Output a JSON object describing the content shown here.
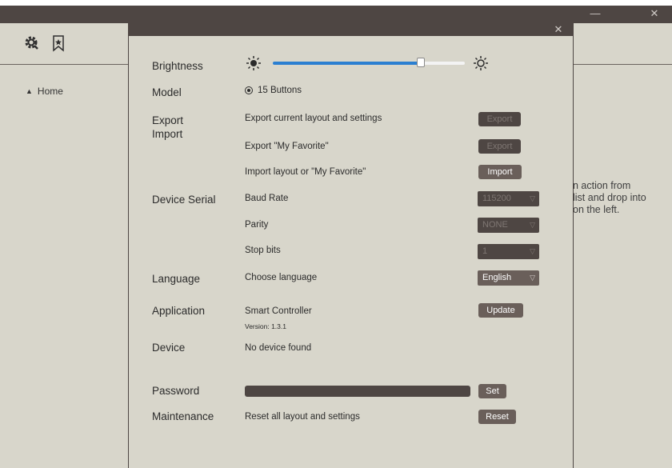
{
  "window": {
    "minimize_glyph": "—",
    "close_glyph": "✕"
  },
  "sidebar": {
    "home_label": "Home",
    "icons": [
      "settings-gear-icon",
      "bookmark-star-icon"
    ]
  },
  "right_panel": {
    "hint_lines": [
      "n action from",
      "list and drop into",
      "on the left."
    ]
  },
  "dialog": {
    "close_glyph": "✕",
    "brightness": {
      "label": "Brightness",
      "value_fraction": 0.77
    },
    "model": {
      "label": "Model",
      "option": "15 Buttons",
      "selected": true
    },
    "export_import": {
      "label_line1": "Export",
      "label_line2": "Import",
      "rows": [
        {
          "text": "Export current layout and settings",
          "button": "Export"
        },
        {
          "text": "Export \"My Favorite\"",
          "button": "Export"
        },
        {
          "text": "Import layout or \"My Favorite\"",
          "button": "Import"
        }
      ]
    },
    "device_serial": {
      "label": "Device Serial",
      "baud": {
        "text": "Baud Rate",
        "value": "115200"
      },
      "parity": {
        "text": "Parity",
        "value": "NONE"
      },
      "stop": {
        "text": "Stop bits",
        "value": "1"
      }
    },
    "language": {
      "label": "Language",
      "text": "Choose language",
      "value": "English"
    },
    "application": {
      "label": "Application",
      "name": "Smart Controller",
      "version": "Version: 1.3.1",
      "button": "Update"
    },
    "device": {
      "label": "Device",
      "status": "No device found"
    },
    "password": {
      "label": "Password",
      "value": "",
      "button": "Set"
    },
    "maintenance": {
      "label": "Maintenance",
      "text": "Reset all layout and settings",
      "button": "Reset"
    }
  },
  "colors": {
    "background": "#d8d6cb",
    "titlebar": "#4e4643",
    "button": "#6a5f5a",
    "disabled_button": "#4e4643",
    "accent": "#2b7fd1"
  }
}
